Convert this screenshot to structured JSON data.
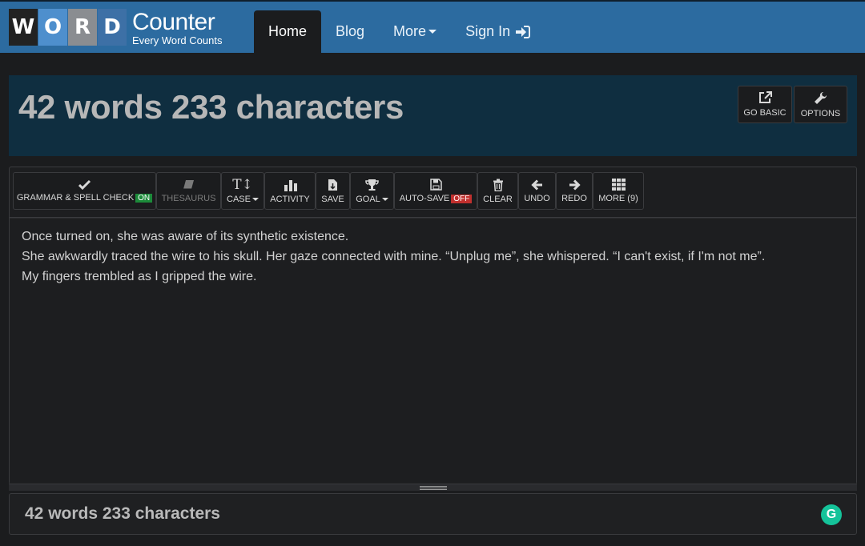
{
  "logo": {
    "tiles": [
      "W",
      "O",
      "R",
      "D"
    ],
    "main": "Counter",
    "sub": "Every Word Counts"
  },
  "nav": {
    "home": "Home",
    "blog": "Blog",
    "more": "More",
    "sign_in": "Sign In"
  },
  "header": {
    "count_title": "42 words 233 characters",
    "go_basic": "GO BASIC",
    "options": "OPTIONS"
  },
  "toolbar": {
    "grammar": "GRAMMAR & SPELL CHECK",
    "grammar_state": "ON",
    "thesaurus": "THESAURUS",
    "case": "CASE",
    "activity": "ACTIVITY",
    "save": "SAVE",
    "goal": "GOAL",
    "autosave": "AUTO-SAVE",
    "autosave_state": "OFF",
    "clear": "CLEAR",
    "undo": "UNDO",
    "redo": "REDO",
    "more": "MORE (9)"
  },
  "editor": {
    "lines": [
      "Once turned on, she was aware of its synthetic existence.",
      "She awkwardly traced the wire to his skull. Her gaze connected with mine. “Unplug me”, she whispered. “I can't exist, if I'm not me”.",
      "My fingers trembled as I gripped the wire."
    ]
  },
  "footer": {
    "count": "42 words 233 characters",
    "grammarly_letter": "G"
  },
  "colors": {
    "navbar": "#2c6ba0",
    "header_panel": "#0f2e40",
    "badge_on": "#1c8a3a",
    "badge_off": "#c0302e",
    "grammarly": "#15c39a"
  }
}
